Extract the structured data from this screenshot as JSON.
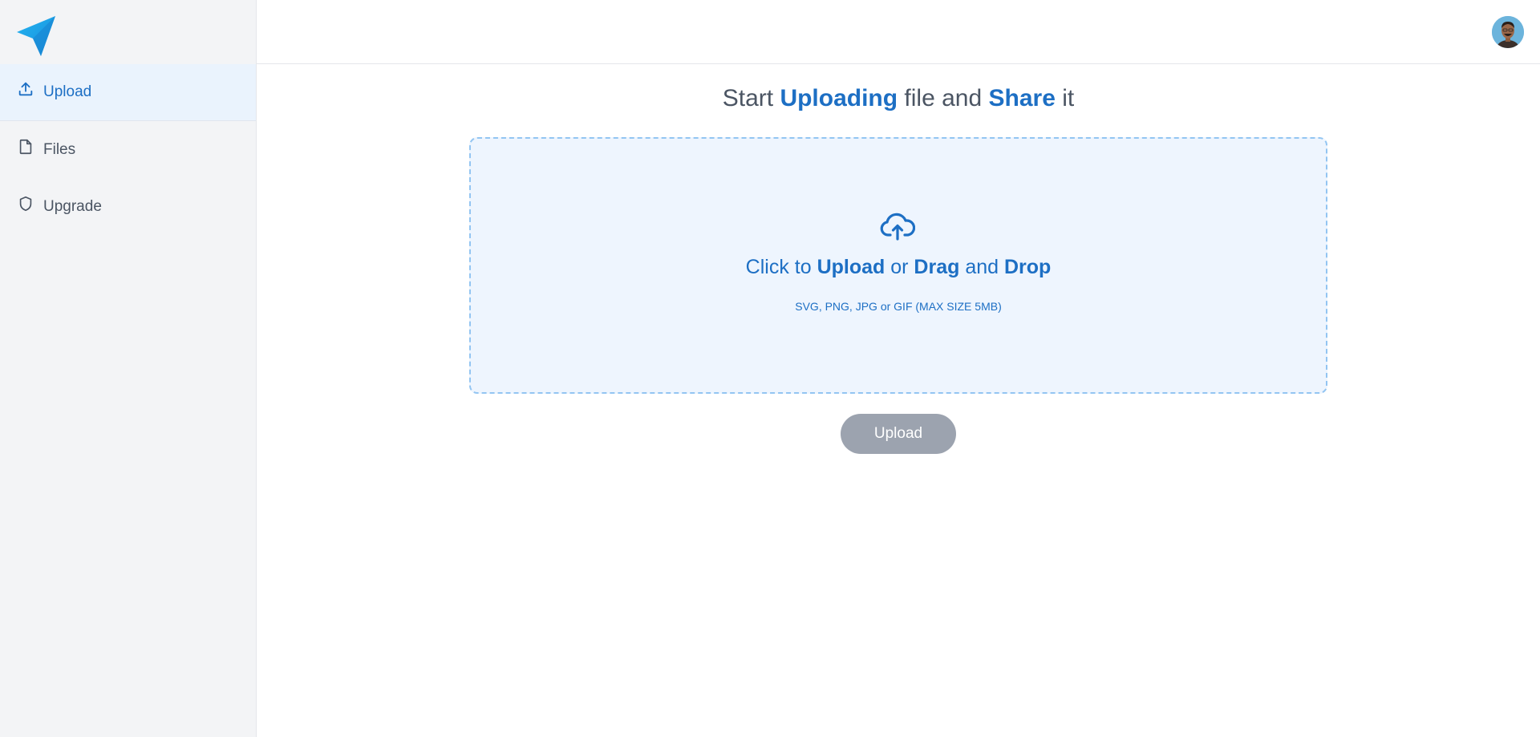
{
  "sidebar": {
    "logo_icon": "paper-plane-icon",
    "items": [
      {
        "label": "Upload",
        "icon": "upload-icon",
        "active": true
      },
      {
        "label": "Files",
        "icon": "file-icon",
        "active": false
      },
      {
        "label": "Upgrade",
        "icon": "shield-icon",
        "active": false
      }
    ]
  },
  "header": {
    "avatar_icon": "user-avatar"
  },
  "main": {
    "title": {
      "part1": "Start ",
      "highlight1": "Uploading",
      "part2": " file and ",
      "highlight2": "Share",
      "part3": " it"
    },
    "dropzone": {
      "icon": "cloud-upload-icon",
      "text_prefix": "Click to ",
      "text_bold1": "Upload",
      "text_mid1": " or ",
      "text_bold2": "Drag",
      "text_mid2": " and ",
      "text_bold3": "Drop",
      "subtext": "SVG, PNG, JPG or GIF (MAX SIZE 5MB)"
    },
    "upload_button_label": "Upload"
  },
  "colors": {
    "accent": "#1d6fc4",
    "sidebar_bg": "#f3f4f6",
    "dropzone_bg": "#eef5fe",
    "dropzone_border": "#93c5f2",
    "button_disabled": "#9ca3af",
    "logo": "#1fa2e8"
  }
}
